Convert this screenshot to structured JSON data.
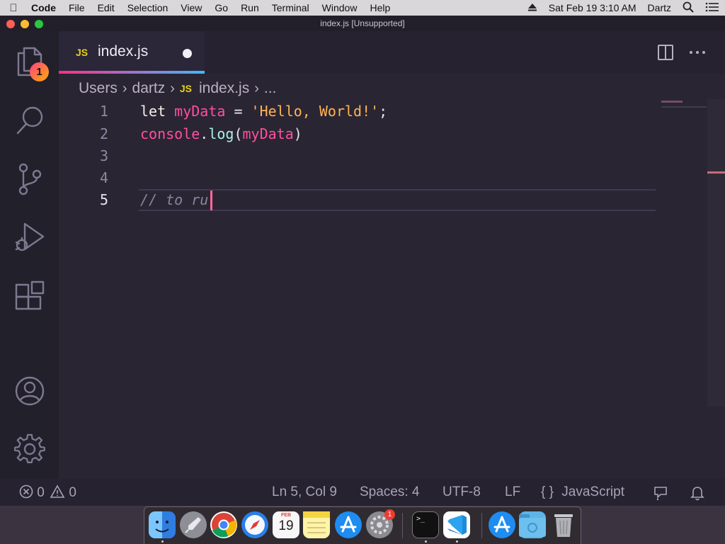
{
  "menubar": {
    "app": "Code",
    "items": [
      "File",
      "Edit",
      "Selection",
      "View",
      "Go",
      "Run",
      "Terminal",
      "Window",
      "Help"
    ],
    "datetime": "Sat Feb 19  3:10 AM",
    "user": "Dartz"
  },
  "window": {
    "title": "index.js [Unsupported]"
  },
  "activity": {
    "explorer_badge": "1"
  },
  "tab": {
    "icon_label": "JS",
    "name": "index.js"
  },
  "breadcrumb": {
    "parts": [
      "Users",
      "dartz",
      "index.js",
      "..."
    ],
    "js_label": "JS"
  },
  "editor": {
    "line_numbers": [
      "1",
      "2",
      "3",
      "4",
      "5"
    ],
    "line1": {
      "kw": "let",
      "var": "myData",
      "op": " = ",
      "str": "'Hello, World!'",
      "end": ";"
    },
    "line2": {
      "obj": "console",
      "dot": ".",
      "fn": "log",
      "open": "(",
      "arg": "myData",
      "close": ")"
    },
    "line5": {
      "comment": "// to ru"
    }
  },
  "statusbar": {
    "errors": "0",
    "warnings": "0",
    "position": "Ln 5, Col 9",
    "spaces": "Spaces: 4",
    "encoding": "UTF-8",
    "eol": "LF",
    "language_icon": "{ }",
    "language": "JavaScript"
  },
  "dock": {
    "calendar_month": "FEB",
    "calendar_day": "19",
    "settings_badge": "1",
    "terminal_prompt": ">_"
  },
  "colors": {
    "accent_pink": "#ff2e88",
    "accent_blue": "#3fb8ff",
    "js_yellow": "#e7d21c"
  }
}
